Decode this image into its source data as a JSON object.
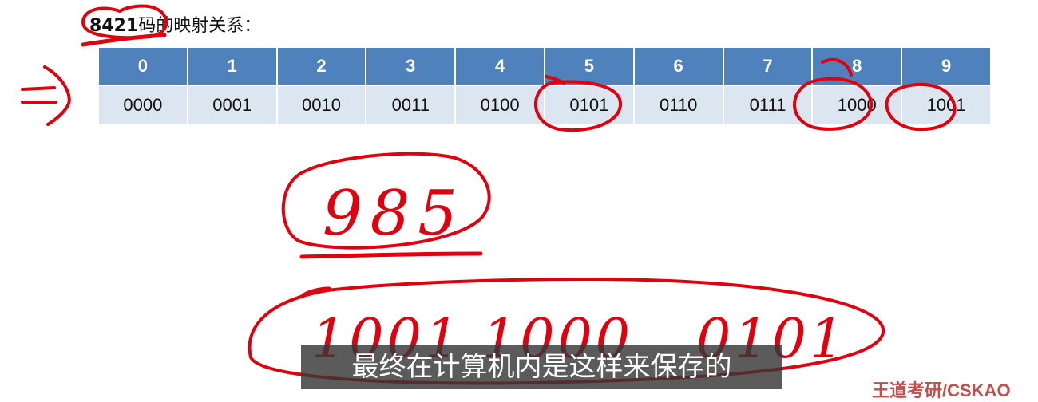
{
  "heading": {
    "code": "8421",
    "text": "码的映射关系："
  },
  "table": {
    "digits": [
      "0",
      "1",
      "2",
      "3",
      "4",
      "5",
      "6",
      "7",
      "8",
      "9"
    ],
    "codes": [
      "0000",
      "0001",
      "0010",
      "0011",
      "0100",
      "0101",
      "0110",
      "0111",
      "1000",
      "1001"
    ]
  },
  "handwriting": {
    "number": "985",
    "encoded": [
      "1001",
      "1000",
      "0101"
    ]
  },
  "subtitle": "最终在计算机内是这样来保存的",
  "watermark": "王道考研/CSKAO",
  "ink_color": "#e0000e"
}
